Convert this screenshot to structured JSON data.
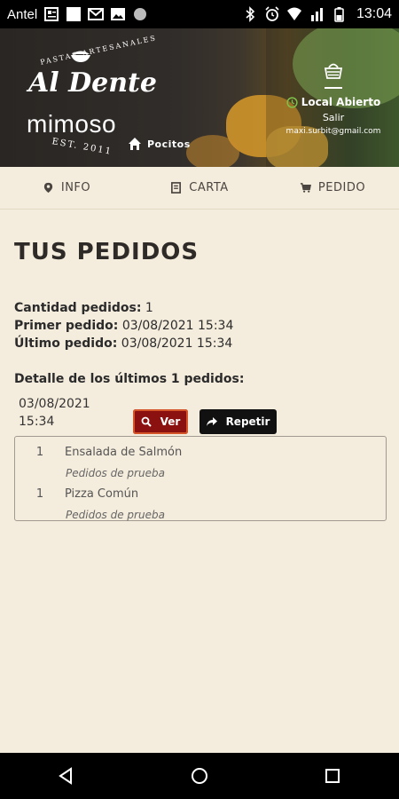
{
  "status_bar": {
    "carrier": "Antel",
    "time": "13:04",
    "icons": [
      "news-icon",
      "blank-icon",
      "mail-icon",
      "image-icon",
      "circle-icon",
      "bluetooth-icon",
      "alarm-icon",
      "wifi-icon",
      "signal-icon",
      "battery-icon"
    ]
  },
  "header": {
    "brand_top": "PASTAS ARTESANALES",
    "brand_name": "Al Dente",
    "brand_sub": "mimoso",
    "brand_est": "EST. 2011",
    "location": "Pocitos",
    "open_status": "Local Abierto",
    "logout": "Salir",
    "email": "maxi.surbit@gmail.com",
    "accent_color": "#7ec24a"
  },
  "tabs": [
    {
      "label": "INFO",
      "icon": "map-pin-icon"
    },
    {
      "label": "CARTA",
      "icon": "menu-book-icon"
    },
    {
      "label": "PEDIDO",
      "icon": "cart-icon"
    }
  ],
  "main": {
    "title": "TUS PEDIDOS",
    "stats": {
      "count_label": "Cantidad pedidos:",
      "count_value": "1",
      "first_label": "Primer pedido:",
      "first_value": "03/08/2021 15:34",
      "last_label": "Último pedido:",
      "last_value": "03/08/2021 15:34"
    },
    "detail_heading": "Detalle de los últimos 1 pedidos:",
    "orders": [
      {
        "date": "03/08/2021",
        "time": "15:34",
        "view_label": "Ver",
        "repeat_label": "Repetir",
        "items": [
          {
            "qty": "1",
            "name": "Ensalada de Salmón",
            "note": "Pedidos de prueba"
          },
          {
            "qty": "1",
            "name": "Pizza Común",
            "note": "Pedidos de prueba"
          }
        ]
      }
    ]
  },
  "colors": {
    "background": "#f4ecdc",
    "view_button": "#8b1010",
    "repeat_button": "#111111"
  }
}
